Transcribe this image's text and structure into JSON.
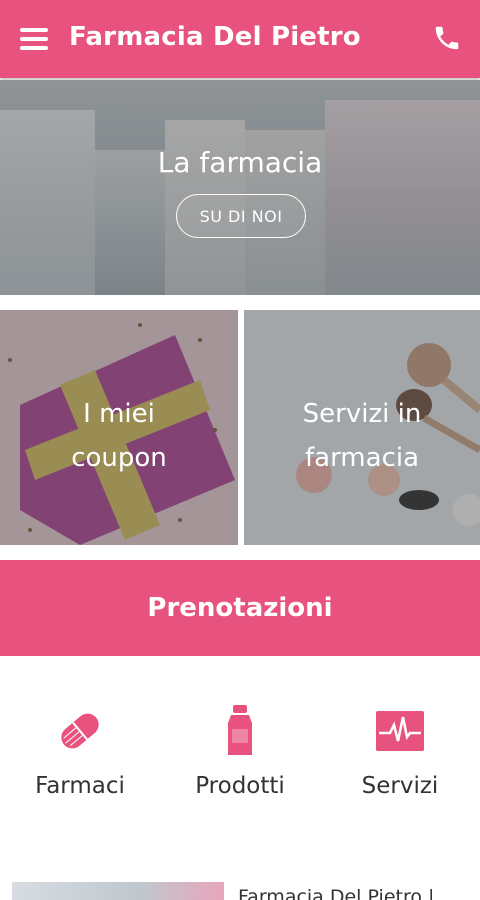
{
  "app_bar": {
    "title": "Farmacia Del Pietro",
    "menu_icon": "hamburger-menu-icon",
    "phone_icon": "phone-icon",
    "color": "#e8527f"
  },
  "hero": {
    "title": "La farmacia",
    "button_label": "SU DI NOI"
  },
  "tiles": [
    {
      "label_line1": "I miei",
      "label_line2": "coupon"
    },
    {
      "label_line1": "Servizi in",
      "label_line2": "farmacia"
    }
  ],
  "booking": {
    "label": "Prenotazioni"
  },
  "categories": [
    {
      "label": "Farmaci",
      "icon": "pill-icon"
    },
    {
      "label": "Prodotti",
      "icon": "bottle-icon"
    },
    {
      "label": "Servizi",
      "icon": "heartbeat-monitor-icon"
    }
  ],
  "news": {
    "title": "Farmacia Del Pietro |"
  },
  "colors": {
    "accent": "#e8527f",
    "text": "#333333"
  }
}
